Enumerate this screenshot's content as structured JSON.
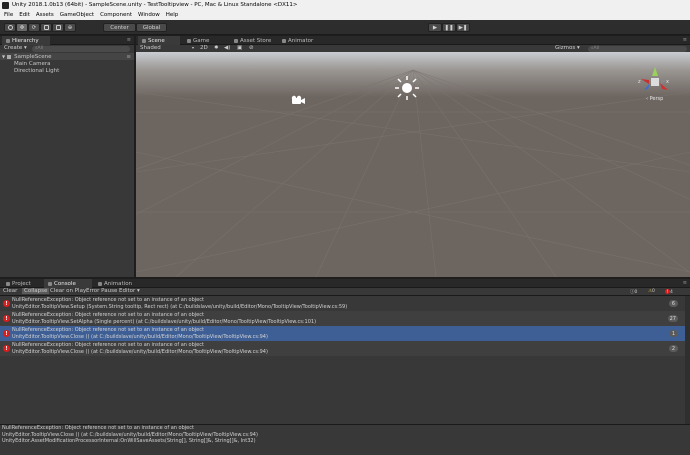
{
  "window": {
    "title": "Unity 2018.1.0b13 (64bit) - SampleScene.unity - TestTooltipview - PC, Mac & Linux Standalone <DX11>"
  },
  "menu": [
    "File",
    "Edit",
    "Assets",
    "GameObject",
    "Component",
    "Window",
    "Help"
  ],
  "toolbar": {
    "pivot_label": "Center",
    "space_label": "Global"
  },
  "hierarchy": {
    "tab_label": "Hierarchy",
    "create_label": "Create ▾",
    "search_placeholder": "⌕All",
    "scene_name": "SampleScene",
    "items": [
      "Main Camera",
      "Directional Light"
    ]
  },
  "scene": {
    "tabs": [
      "Scene",
      "Game",
      "Asset Store",
      "Animator"
    ],
    "shading_label": "Shaded",
    "mode_2d": "2D",
    "gizmos_label": "Gizmos ▾",
    "search_placeholder": "⌕All",
    "persp_label": "‹ Persp",
    "axis_x": "x",
    "axis_z": "z"
  },
  "bottom_tabs": [
    "Project",
    "Console",
    "Animation"
  ],
  "console": {
    "buttons": [
      "Clear",
      "Collapse",
      "Clear on Play",
      "Error Pause",
      "Editor ▾"
    ],
    "info_count": "0",
    "warn_count": "0",
    "error_count": "4",
    "entries": [
      {
        "line1": "NullReferenceException: Object reference not set to an instance of an object",
        "line2": "UnityEditor.TooltipView.Setup (System.String tooltip, Rect rect) (at C:/buildslave/unity/build/Editor/Mono/TooltipView/TooltipView.cs:59)",
        "count": "6"
      },
      {
        "line1": "NullReferenceException: Object reference not set to an instance of an object",
        "line2": "UnityEditor.TooltipView.SetAlpha (Single percent) (at C:/buildslave/unity/build/Editor/Mono/TooltipView/TooltipView.cs:101)",
        "count": "27"
      },
      {
        "line1": "NullReferenceException: Object reference not set to an instance of an object",
        "line2": "UnityEditor.TooltipView.Close () (at C:/buildslave/unity/build/Editor/Mono/TooltipView/TooltipView.cs:94)",
        "count": "1"
      },
      {
        "line1": "NullReferenceException: Object reference not set to an instance of an object",
        "line2": "UnityEditor.TooltipView.Close () (at C:/buildslave/unity/build/Editor/Mono/TooltipView/TooltipView.cs:94)",
        "count": "2"
      }
    ],
    "detail": [
      "NullReferenceException: Object reference not set to an instance of an object",
      "UnityEditor.TooltipView.Close () (at C:/buildslave/unity/build/Editor/Mono/TooltipView/TooltipView.cs:94)",
      "UnityEditor.AssetModificationProcessorInternal:OnWillSaveAssets(String[], String[]&, String[]&, Int32)"
    ]
  },
  "colors": {
    "selection": "#3e5f96",
    "error": "#d81e1e",
    "scene_bg": "#6d6560",
    "panel": "#383838"
  }
}
